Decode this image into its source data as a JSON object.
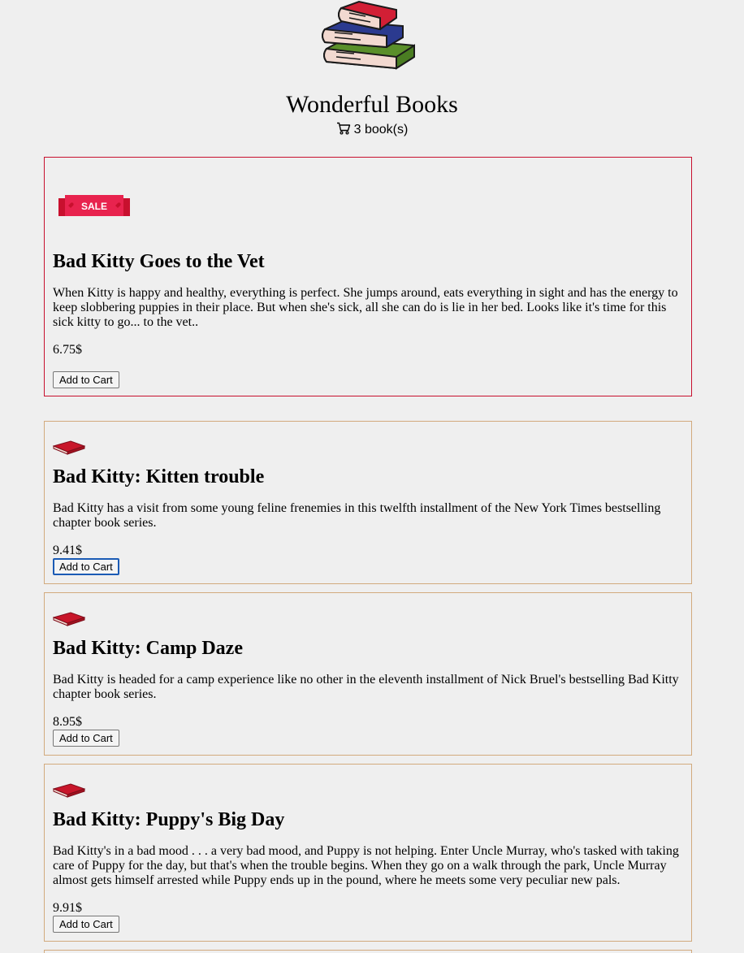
{
  "site": {
    "title": "Wonderful Books",
    "logo": "stack-of-books-icon"
  },
  "cart": {
    "icon": "shopping-cart-icon",
    "label": "3 book(s)"
  },
  "colors": {
    "background": "#efefef",
    "card_border": "#d2aa7d",
    "sale_border": "#c8102e",
    "sale_ribbon": "#e8234e",
    "focus_ring": "#1b5bb5"
  },
  "books": [
    {
      "title": "Bad Kitty Goes to the Vet",
      "description": "When Kitty is happy and healthy, everything is perfect. She jumps around, eats everything in sight and has the energy to keep slobbering puppies in their place. But when she's sick, all she can do is lie in her bed. Looks like it's time for this sick kitty to go... to the vet..",
      "price": "6.75$",
      "button": "Add to Cart",
      "badge": "SALE",
      "on_sale": true
    },
    {
      "title": "Bad Kitty: Kitten trouble",
      "description": "Bad Kitty has a visit from some young feline frenemies in this twelfth installment of the New York Times bestselling chapter book series.",
      "price": "9.41$",
      "button": "Add to Cart",
      "on_sale": false,
      "button_focused": true
    },
    {
      "title": "Bad Kitty: Camp Daze",
      "description": "Bad Kitty is headed for a camp experience like no other in the eleventh installment of Nick Bruel's bestselling Bad Kitty chapter book series.",
      "price": "8.95$",
      "button": "Add to Cart",
      "on_sale": false
    },
    {
      "title": "Bad Kitty: Puppy's Big Day",
      "description": "Bad Kitty's in a bad mood . . . a very bad mood, and Puppy is not helping. Enter Uncle Murray, who's tasked with taking care of Puppy for the day, but that's when the trouble begins. When they go on a walk through the park, Uncle Murray almost gets himself arrested while Puppy ends up in the pound, where he meets some very peculiar new pals.",
      "price": "9.91$",
      "button": "Add to Cart",
      "on_sale": false
    }
  ]
}
